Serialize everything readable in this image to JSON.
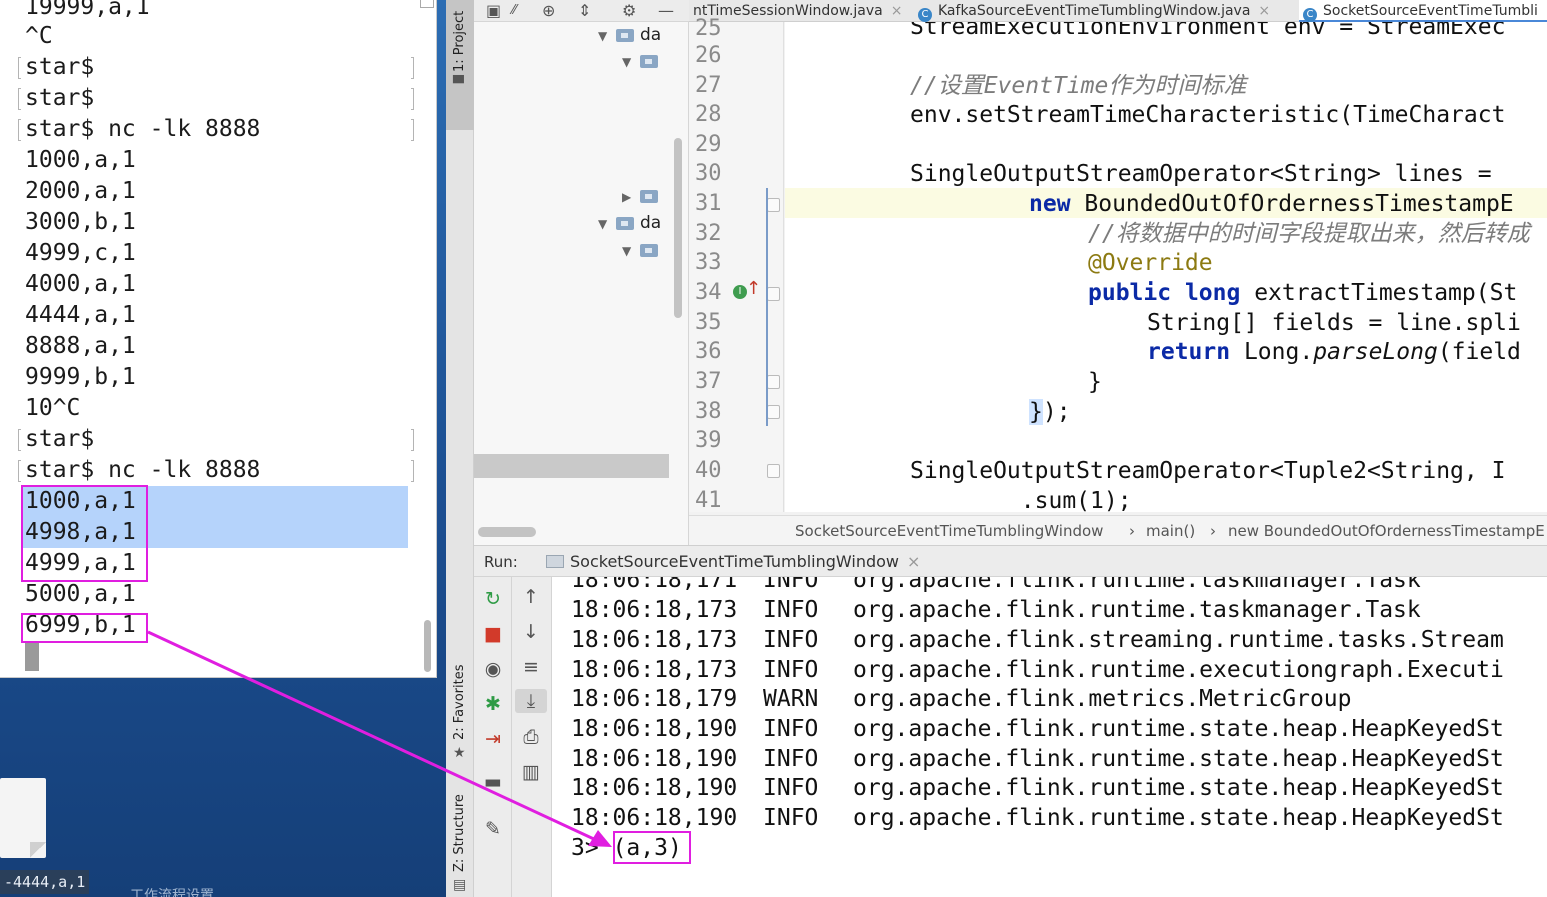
{
  "terminal": {
    "lines": [
      {
        "text": "19999,a,1"
      },
      {
        "text": "^C"
      },
      {
        "text": "star$"
      },
      {
        "text": "star$"
      },
      {
        "text": "star$ nc -lk 8888"
      },
      {
        "text": "1000,a,1"
      },
      {
        "text": "2000,a,1"
      },
      {
        "text": "3000,b,1"
      },
      {
        "text": "4999,c,1"
      },
      {
        "text": "4000,a,1"
      },
      {
        "text": "4444,a,1"
      },
      {
        "text": "8888,a,1"
      },
      {
        "text": "9999,b,1"
      },
      {
        "text": "10^C"
      },
      {
        "text": "star$"
      },
      {
        "text": "star$ nc -lk 8888"
      },
      {
        "text": "1000,a,1"
      },
      {
        "text": "4998,a,1"
      },
      {
        "text": "4999,a,1"
      },
      {
        "text": "5000,a,1"
      },
      {
        "text": "6999,b,1"
      }
    ]
  },
  "desktop": {
    "file_label": "-4444,a,1",
    "partial_label": "工作流程设置"
  },
  "ide": {
    "left_strip": {
      "project": "1: Project",
      "favorites": "2: Favorites",
      "structure": "Z: Structure"
    },
    "project_tree": {
      "row1": "da",
      "row2": "",
      "row3": "",
      "row4": "da",
      "row5": ""
    },
    "tabs": [
      {
        "label": "ntTimeSessionWindow.java"
      },
      {
        "label": "KafkaSourceEventTimeTumblingWindow.java"
      },
      {
        "label": "SocketSourceEventTimeTumbli"
      }
    ],
    "editor": {
      "line_numbers": [
        "25",
        "26",
        "27",
        "28",
        "29",
        "30",
        "31",
        "32",
        "33",
        "34",
        "35",
        "36",
        "37",
        "38",
        "39",
        "40",
        "41"
      ],
      "code": {
        "l25": "StreamExecutionEnvironment env = StreamExec",
        "l27": "//设置EventTime作为时间标准",
        "l28": "env.setStreamTimeCharacteristic(TimeCharact",
        "l30": "SingleOutputStreamOperator<String> lines =",
        "l31_kw": "new",
        "l31_rest": " BoundedOutOfOrdernessTimestampE",
        "l32": "//将数据中的时间字段提取出来，然后转成",
        "l33": "@Override",
        "l34_kw1": "public",
        "l34_kw2": "long",
        "l34_rest": " extractTimestamp(St",
        "l35": "String[] fields = line.spli",
        "l36_kw": "return",
        "l36_a": " Long.",
        "l36_b": "parseLong",
        "l36_c": "(field",
        "l37": "}",
        "l38_brace": "}",
        "l38_rest": ");",
        "l40": "SingleOutputStreamOperator<Tuple2<String, I",
        "l41": "        .sum(1);"
      }
    },
    "breadcrumb": {
      "class": "SocketSourceEventTimeTumblingWindow",
      "method": "main()",
      "anon": "new BoundedOutOfOrdernessTimestampE"
    },
    "run": {
      "label": "Run:",
      "tab": "SocketSourceEventTimeTumblingWindow"
    },
    "console": {
      "lines": [
        {
          "ts": "18:06:18,171",
          "lvl": "INFO",
          "msg": "org.apache.flink.runtime.taskmanager.Task"
        },
        {
          "ts": "18:06:18,173",
          "lvl": "INFO",
          "msg": "org.apache.flink.runtime.taskmanager.Task"
        },
        {
          "ts": "18:06:18,173",
          "lvl": "INFO",
          "msg": "org.apache.flink.streaming.runtime.tasks.Stream"
        },
        {
          "ts": "18:06:18,173",
          "lvl": "INFO",
          "msg": "org.apache.flink.runtime.executiongraph.Executi"
        },
        {
          "ts": "18:06:18,179",
          "lvl": "WARN",
          "msg": "org.apache.flink.metrics.MetricGroup"
        },
        {
          "ts": "18:06:18,190",
          "lvl": "INFO",
          "msg": "org.apache.flink.runtime.state.heap.HeapKeyedSt"
        },
        {
          "ts": "18:06:18,190",
          "lvl": "INFO",
          "msg": "org.apache.flink.runtime.state.heap.HeapKeyedSt"
        },
        {
          "ts": "18:06:18,190",
          "lvl": "INFO",
          "msg": "org.apache.flink.runtime.state.heap.HeapKeyedSt"
        },
        {
          "ts": "18:06:18,190",
          "lvl": "INFO",
          "msg": "org.apache.flink.runtime.state.heap.HeapKeyedSt"
        }
      ],
      "result_prefix": "3>",
      "result_value": "(a,3)"
    }
  },
  "colors": {
    "highlight_box": "#e01ee0",
    "selection": "#b5d3fb",
    "keyword": "#0b2aa6"
  }
}
